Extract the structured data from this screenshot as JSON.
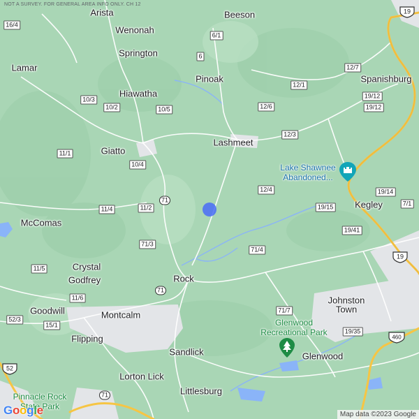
{
  "header_note": "NOT A SURVEY. FOR GENERAL AREA INFO ONLY. CH 12",
  "places": [
    {
      "name": "Arista",
      "key": "arista"
    },
    {
      "name": "Beeson",
      "key": "beeson"
    },
    {
      "name": "Wenonah",
      "key": "wenonah"
    },
    {
      "name": "Springton",
      "key": "springton"
    },
    {
      "name": "Lamar",
      "key": "lamar"
    },
    {
      "name": "Pinoak",
      "key": "pinoak"
    },
    {
      "name": "Spanishburg",
      "key": "spanishburg"
    },
    {
      "name": "Hiawatha",
      "key": "hiawatha"
    },
    {
      "name": "Lashmeet",
      "key": "lashmeet"
    },
    {
      "name": "Giatto",
      "key": "giatto"
    },
    {
      "name": "Kegley",
      "key": "kegley"
    },
    {
      "name": "McComas",
      "key": "mccomas"
    },
    {
      "name": "Crystal",
      "key": "crystal"
    },
    {
      "name": "Godfrey",
      "key": "godfrey"
    },
    {
      "name": "Rock",
      "key": "rock"
    },
    {
      "name": "Johnston",
      "key": "johnston"
    },
    {
      "name": "Town",
      "key": "town"
    },
    {
      "name": "Goodwill",
      "key": "goodwill"
    },
    {
      "name": "Montcalm",
      "key": "montcalm"
    },
    {
      "name": "Flipping",
      "key": "flipping"
    },
    {
      "name": "Sandlick",
      "key": "sandlick"
    },
    {
      "name": "Glenwood",
      "key": "glenwood"
    },
    {
      "name": "Lorton Lick",
      "key": "lorton-lick"
    },
    {
      "name": "Littlesburg",
      "key": "littlesburg"
    }
  ],
  "pois": [
    {
      "key": "lake-shawnee",
      "lines": [
        "Lake Shawnee",
        "Abandoned..."
      ],
      "type": "attraction"
    },
    {
      "key": "glenwood-park",
      "lines": [
        "Glenwood",
        "Recreational Park"
      ],
      "type": "park"
    },
    {
      "key": "pinnacle-rock",
      "lines": [
        "Pinnacle Rock",
        "State Park"
      ],
      "type": "park"
    }
  ],
  "route_shields": [
    {
      "label": "16/4",
      "key": "16-4"
    },
    {
      "label": "6/1",
      "key": "6-1"
    },
    {
      "label": "6",
      "key": "6"
    },
    {
      "label": "12/7",
      "key": "12-7"
    },
    {
      "label": "12/1",
      "key": "12-1"
    },
    {
      "label": "10/3",
      "key": "10-3"
    },
    {
      "label": "10/2",
      "key": "10-2"
    },
    {
      "label": "10/5",
      "key": "10-5"
    },
    {
      "label": "12/6",
      "key": "12-6"
    },
    {
      "label": "19/12",
      "key": "19-12"
    },
    {
      "label": "12/3",
      "key": "12-3"
    },
    {
      "label": "11/1",
      "key": "11-1"
    },
    {
      "label": "10/4",
      "key": "10-4"
    },
    {
      "label": "12/4",
      "key": "12-4"
    },
    {
      "label": "19/14",
      "key": "19-14"
    },
    {
      "label": "7/1",
      "key": "7-1"
    },
    {
      "label": "71",
      "key": "71a"
    },
    {
      "label": "11/4",
      "key": "11-4"
    },
    {
      "label": "11/2",
      "key": "11-2"
    },
    {
      "label": "19/15",
      "key": "19-15"
    },
    {
      "label": "19/41",
      "key": "19-41"
    },
    {
      "label": "71/3",
      "key": "71-3"
    },
    {
      "label": "71/4",
      "key": "71-4"
    },
    {
      "label": "11/5",
      "key": "11-5"
    },
    {
      "label": "71",
      "key": "71b"
    },
    {
      "label": "11/6",
      "key": "11-6"
    },
    {
      "label": "71/7",
      "key": "71-7"
    },
    {
      "label": "52/3",
      "key": "52-3"
    },
    {
      "label": "15/1",
      "key": "15-1"
    },
    {
      "label": "19/35",
      "key": "19-35"
    },
    {
      "label": "71",
      "key": "71c"
    },
    {
      "label": "19/12",
      "key": "19-12b"
    }
  ],
  "us_shields": [
    {
      "label": "19",
      "key": "us19a"
    },
    {
      "label": "19",
      "key": "us19b"
    },
    {
      "label": "460",
      "key": "us460"
    },
    {
      "label": "52",
      "key": "us52"
    }
  ],
  "branding": {
    "logo_letters": [
      "G",
      "o",
      "o",
      "g",
      "l",
      "e"
    ],
    "logo_colors": [
      "#4285F4",
      "#EA4335",
      "#FBBC05",
      "#4285F4",
      "#34A853",
      "#EA4335"
    ]
  },
  "attribution": "Map data ©2023 Google",
  "colors": {
    "terrain": "#a9d6b5",
    "urban": "#e3e5e8",
    "water": "#8ab4f8",
    "major_road": "#f6c544",
    "minor_road": "#ffffff",
    "park_green": "#1e8c45",
    "poi_blue": "#1a73a8",
    "marker": "#4a6cf7"
  }
}
